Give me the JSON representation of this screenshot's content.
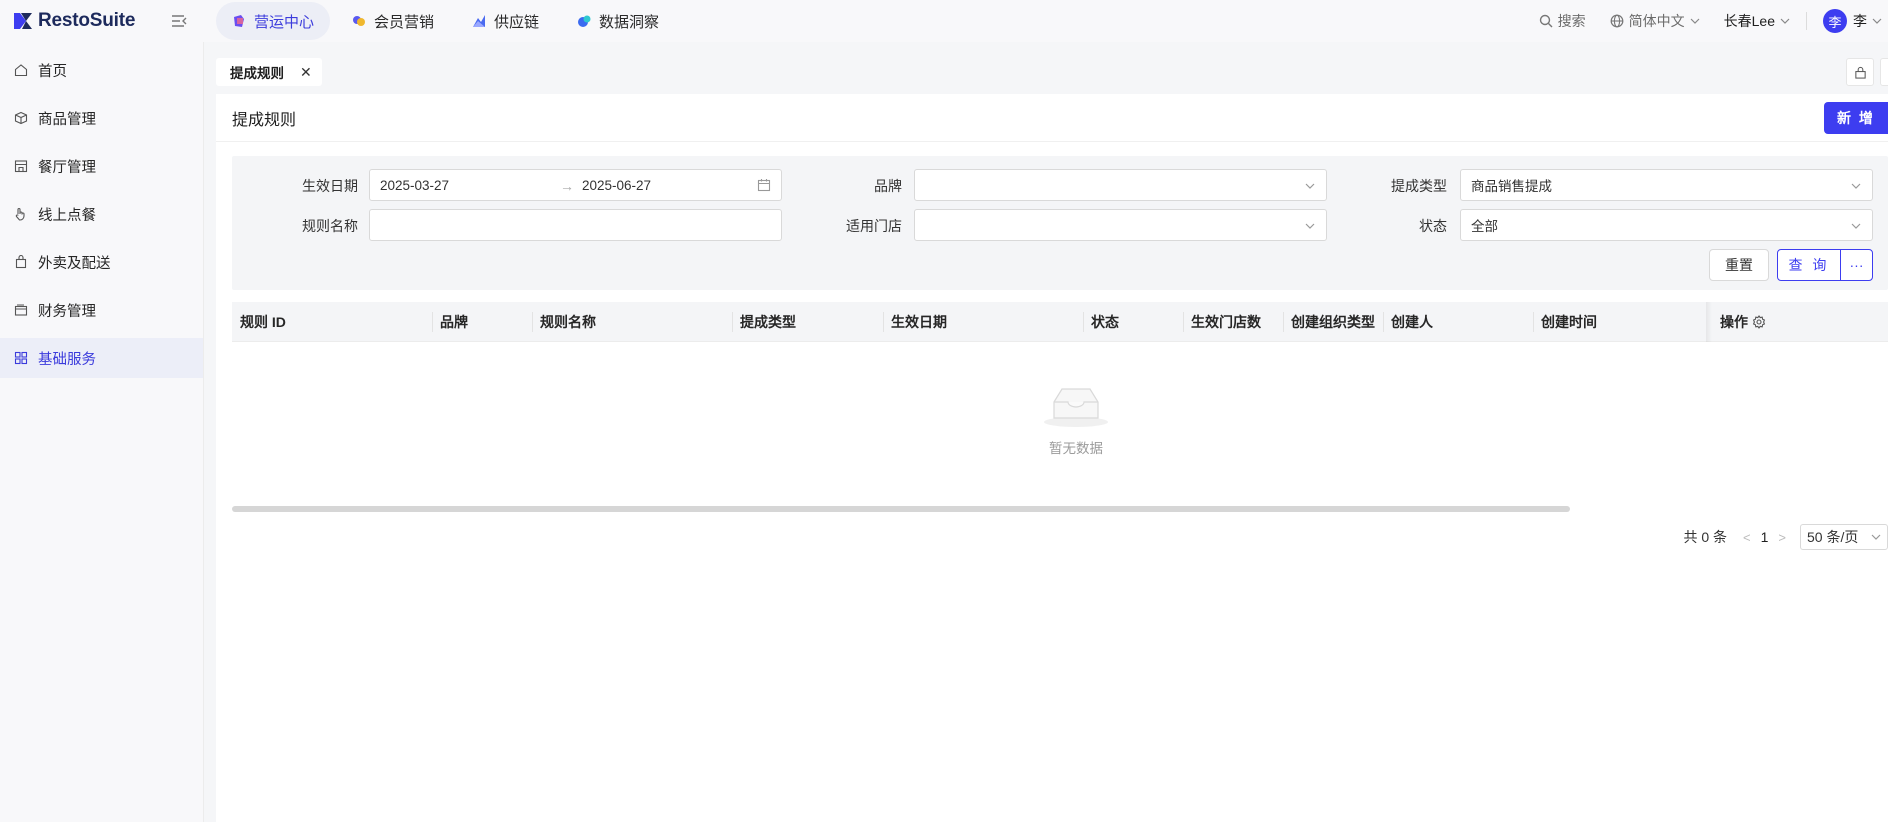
{
  "app": {
    "brand": "RestoSuite"
  },
  "top_nav": [
    {
      "label": "营运中心",
      "active": true,
      "icon": "cube-icon"
    },
    {
      "label": "会员营销",
      "active": false,
      "icon": "coins-icon"
    },
    {
      "label": "供应链",
      "active": false,
      "icon": "chart-icon"
    },
    {
      "label": "数据洞察",
      "active": false,
      "icon": "bubble-icon"
    }
  ],
  "top_right": {
    "search": "搜索",
    "language": "简体中文",
    "org": "长春Lee",
    "user_avatar": "李",
    "user_name": "李"
  },
  "sidebar": [
    {
      "label": "首页",
      "icon": "home-icon"
    },
    {
      "label": "商品管理",
      "icon": "box-icon"
    },
    {
      "label": "餐厅管理",
      "icon": "store-icon"
    },
    {
      "label": "线上点餐",
      "icon": "hand-icon"
    },
    {
      "label": "外卖及配送",
      "icon": "bag-icon"
    },
    {
      "label": "财务管理",
      "icon": "wallet-icon"
    },
    {
      "label": "基础服务",
      "icon": "grid-icon",
      "active": true
    }
  ],
  "tabs": [
    {
      "label": "提成规则"
    }
  ],
  "page": {
    "title": "提成规则",
    "new_button": "新 增"
  },
  "filters": {
    "effective_date": {
      "label": "生效日期",
      "start": "2025-03-27",
      "end": "2025-06-27"
    },
    "brand": {
      "label": "品牌",
      "value": ""
    },
    "commission_type": {
      "label": "提成类型",
      "value": "商品销售提成"
    },
    "rule_name": {
      "label": "规则名称",
      "value": ""
    },
    "store": {
      "label": "适用门店",
      "value": ""
    },
    "status": {
      "label": "状态",
      "value": "全部"
    },
    "reset_button": "重置",
    "query_button": "查 询",
    "more_button": "···"
  },
  "table": {
    "columns": [
      "规则 ID",
      "品牌",
      "规则名称",
      "提成类型",
      "生效日期",
      "状态",
      "生效门店数",
      "创建组织类型",
      "创建人",
      "创建时间",
      "操作"
    ],
    "empty_text": "暂无数据"
  },
  "pagination": {
    "total": "共 0 条",
    "current": "1",
    "page_size": "50 条/页"
  },
  "colors": {
    "primary": "#3d3df0",
    "active_bg": "#eceef6"
  }
}
